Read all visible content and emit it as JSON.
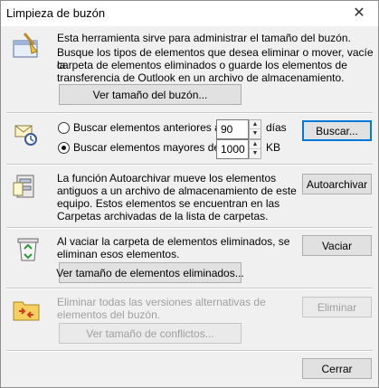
{
  "window": {
    "title": "Limpieza de buzón"
  },
  "section1": {
    "line1": "Esta herramienta sirve para administrar el tamaño del buzón.",
    "line2": "Busque los tipos de elementos que desea eliminar o mover, vacíe la",
    "line3": "carpeta de elementos eliminados o guarde los elementos de",
    "line4": "transferencia de Outlook en un archivo de almacenamiento.",
    "button": "Ver tamaño del buzón..."
  },
  "section2": {
    "radio1_label": "Buscar elementos anteriores a",
    "radio1_value": "90",
    "radio1_unit": "días",
    "radio2_label": "Buscar elementos mayores de",
    "radio2_value": "1000",
    "radio2_unit": "KB",
    "search_button": "Buscar..."
  },
  "section3": {
    "line1": "La función Autoarchivar mueve los elementos",
    "line2": "antiguos a un archivo de almacenamiento de este",
    "line3": "equipo. Estos elementos se encuentran en las",
    "line4": "Carpetas archivadas de la lista de carpetas.",
    "button": "Autoarchivar"
  },
  "section4": {
    "line1": "Al vaciar la carpeta de elementos eliminados, se",
    "line2": "eliminan esos elementos.",
    "empty_button": "Vaciar",
    "view_button": "Ver tamaño de elementos eliminados..."
  },
  "section5": {
    "line1": "Eliminar todas las versiones alternativas de",
    "line2": "elementos del buzón.",
    "delete_button": "Eliminar",
    "view_button": "Ver tamaño de conflictos..."
  },
  "footer": {
    "close_button": "Cerrar"
  },
  "colors": {
    "accent": "#0078d7",
    "face": "#f0f0f0",
    "disabled_text": "#9f9f9f"
  }
}
